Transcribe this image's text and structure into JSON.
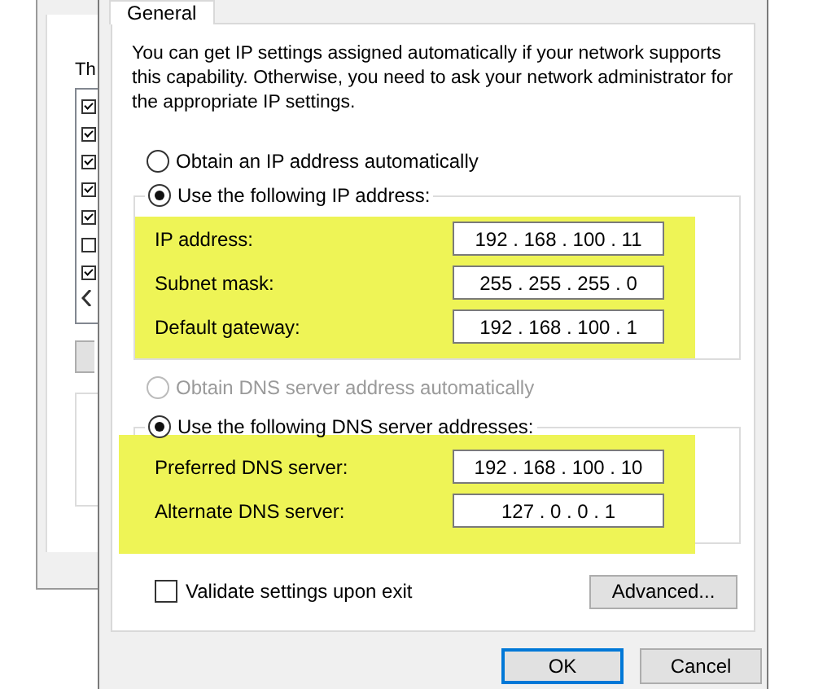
{
  "background_window": {
    "text": "Th",
    "list_items": [
      {
        "checked": true
      },
      {
        "checked": true
      },
      {
        "checked": true
      },
      {
        "checked": true
      },
      {
        "checked": true
      },
      {
        "checked": false
      },
      {
        "checked": true
      }
    ]
  },
  "dialog": {
    "tabs": [
      {
        "label": "General",
        "selected": true
      }
    ],
    "intro": "You can get IP settings assigned automatically if your network supports this capability. Otherwise, you need to ask your network administrator for the appropriate IP settings.",
    "ip_mode": [
      {
        "label": "Obtain an IP address automatically",
        "selected": false,
        "disabled": false
      },
      {
        "label": "Use the following IP address:",
        "selected": true,
        "disabled": false
      }
    ],
    "ip_fields": [
      {
        "label": "IP address:",
        "value": "192 . 168 . 100 . 11"
      },
      {
        "label": "Subnet mask:",
        "value": "255 . 255 . 255 . 0"
      },
      {
        "label": "Default gateway:",
        "value": "192 . 168 . 100 . 1"
      }
    ],
    "dns_mode": [
      {
        "label": "Obtain DNS server address automatically",
        "selected": false,
        "disabled": true
      },
      {
        "label": "Use the following DNS server addresses:",
        "selected": true,
        "disabled": false
      }
    ],
    "dns_fields": [
      {
        "label": "Preferred DNS server:",
        "value": "192 . 168 . 100 . 10"
      },
      {
        "label": "Alternate DNS server:",
        "value": "127 . 0 . 0 . 1"
      }
    ],
    "validate": {
      "label": "Validate settings upon exit",
      "checked": false
    },
    "advanced_button": "Advanced...",
    "buttons": [
      {
        "label": "OK",
        "default": true
      },
      {
        "label": "Cancel",
        "default": false
      }
    ]
  }
}
